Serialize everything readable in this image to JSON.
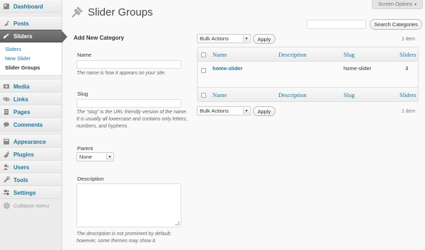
{
  "sidebar": {
    "items": [
      {
        "label": "Dashboard",
        "icon": "dashboard-icon"
      },
      {
        "label": "Posts",
        "icon": "pin-icon"
      },
      {
        "label": "Sliders",
        "icon": "sliders-icon",
        "current": true
      },
      {
        "label": "Media",
        "icon": "media-icon"
      },
      {
        "label": "Links",
        "icon": "link-icon"
      },
      {
        "label": "Pages",
        "icon": "pages-icon"
      },
      {
        "label": "Comments",
        "icon": "comment-icon"
      },
      {
        "label": "Appearance",
        "icon": "appearance-icon"
      },
      {
        "label": "Plugins",
        "icon": "plugin-icon"
      },
      {
        "label": "Users",
        "icon": "users-icon"
      },
      {
        "label": "Tools",
        "icon": "tools-icon"
      },
      {
        "label": "Settings",
        "icon": "settings-icon"
      }
    ],
    "submenu": [
      "Sliders",
      "New Slider",
      "Slider Groups"
    ],
    "collapse_label": "Collapse menu"
  },
  "header": {
    "title": "Slider Groups",
    "screen_options": "Screen Options"
  },
  "search": {
    "value": "",
    "button": "Search Categories"
  },
  "form": {
    "heading": "Add New Category",
    "name_label": "Name",
    "name_hint": "The name is how it appears on your site.",
    "slug_label": "Slug",
    "slug_hint": "The “slug” is the URL-friendly version of the name. It is usually all lowercase and contains only letters, numbers, and hyphens.",
    "parent_label": "Parent",
    "parent_value": "None",
    "description_label": "Description",
    "description_hint": "The description is not prominent by default; however, some themes may show it."
  },
  "table": {
    "bulk_actions": "Bulk Actions",
    "apply": "Apply",
    "item_count": "1 item",
    "columns": [
      "Name",
      "Description",
      "Slug",
      "Sliders"
    ],
    "rows": [
      {
        "name": "home-slider",
        "description": "",
        "slug": "home-slider",
        "sliders": "3"
      }
    ]
  },
  "colors": {
    "link": "#21759b",
    "sidebar_bg": "#ececec",
    "current_menu": "#6d6d6d"
  }
}
